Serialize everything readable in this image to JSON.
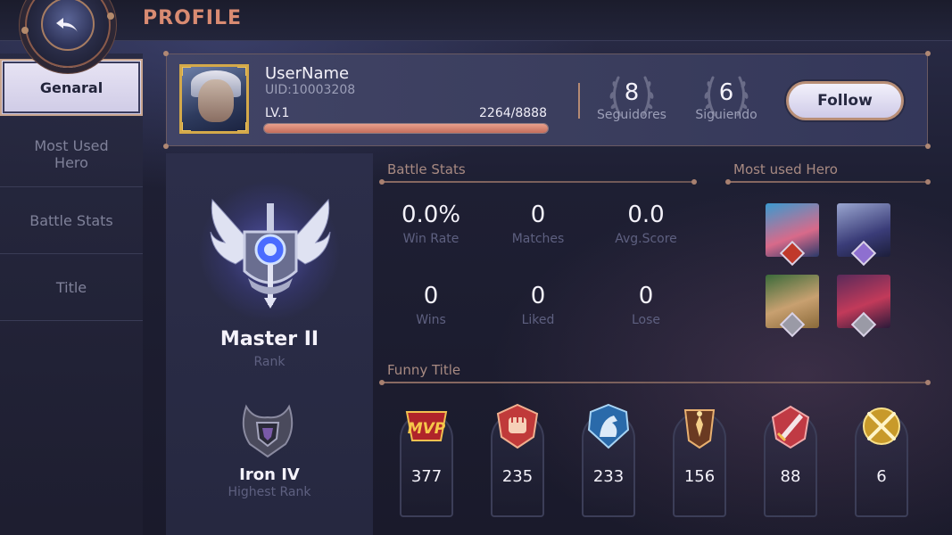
{
  "header": {
    "title": "PROFILE",
    "back_icon": "back-arrow-icon"
  },
  "sidebar": {
    "items": [
      {
        "label": "Genaral",
        "active": true
      },
      {
        "label": "Most Used Hero",
        "active": false
      },
      {
        "label": "Battle Stats",
        "active": false
      },
      {
        "label": "Title",
        "active": false
      }
    ]
  },
  "profile": {
    "username": "UserName",
    "uid": "UID:10003208",
    "level": "LV.1",
    "xp": "2264/8888",
    "xp_progress": 1.0,
    "followers_count": "8",
    "followers_label": "Seguidores",
    "following_count": "6",
    "following_label": "Siguiendo",
    "follow_button": "Follow"
  },
  "rank": {
    "current_name": "Master II",
    "current_label": "Rank",
    "highest_name": "Iron IV",
    "highest_label": "Highest Rank"
  },
  "battle_stats": {
    "title": "Battle Stats",
    "items": [
      {
        "value": "0.0%",
        "label": "Win Rate"
      },
      {
        "value": "0",
        "label": "Matches"
      },
      {
        "value": "0.0",
        "label": "Avg.Score"
      },
      {
        "value": "0",
        "label": "Wins"
      },
      {
        "value": "0",
        "label": "Liked"
      },
      {
        "value": "0",
        "label": "Lose"
      }
    ]
  },
  "most_used_hero": {
    "title": "Most used Hero",
    "heroes": [
      {
        "icon": "hero-portrait-glasses-girl",
        "badge_color": "#c0392b"
      },
      {
        "icon": "hero-portrait-silver-hair",
        "badge_color": "#8e6fd0"
      },
      {
        "icon": "hero-portrait-green-hair",
        "badge_color": "#9a9aa6"
      },
      {
        "icon": "hero-portrait-crimson-armor",
        "badge_color": "#9a9aa6"
      }
    ]
  },
  "funny_title": {
    "title": "Funny Title",
    "medals": [
      {
        "icon": "mvp-medal-icon",
        "count": "377"
      },
      {
        "icon": "fist-medal-icon",
        "count": "235"
      },
      {
        "icon": "wolf-medal-icon",
        "count": "233"
      },
      {
        "icon": "tower-medal-icon",
        "count": "156"
      },
      {
        "icon": "sword-medal-icon",
        "count": "88"
      },
      {
        "icon": "crossed-swords-medal-icon",
        "count": "6"
      }
    ]
  },
  "colors": {
    "accent": "#d98b72",
    "gold": "#d4a94a",
    "panel": "#3a3d5d"
  }
}
